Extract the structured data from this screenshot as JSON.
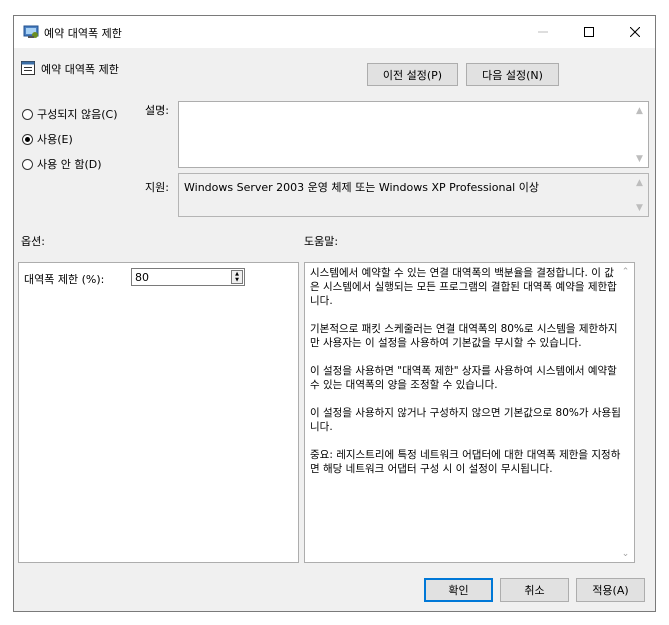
{
  "window": {
    "title": "예약 대역폭 제한",
    "minimize_icon": "minimize-icon",
    "maximize_icon": "maximize-icon",
    "close_icon": "close-icon"
  },
  "header": {
    "setting_title": "예약 대역폭 제한",
    "prev_button": "이전 설정(P)",
    "next_button": "다음 설정(N)"
  },
  "state": {
    "options": [
      {
        "label": "구성되지 않음(C)",
        "selected": false
      },
      {
        "label": "사용(E)",
        "selected": true
      },
      {
        "label": "사용 안 함(D)",
        "selected": false
      }
    ]
  },
  "labels": {
    "comment": "설명:",
    "supported": "지원:",
    "options": "옵션:",
    "help": "도움말:"
  },
  "comment": {
    "value": ""
  },
  "supported": {
    "value": "Windows Server 2003 운영 체제 또는 Windows XP Professional 이상"
  },
  "options_panel": {
    "bandwidth_label": "대역폭 제한 (%):",
    "bandwidth_value": "80"
  },
  "help_text": [
    "시스템에서 예약할 수 있는 연결 대역폭의 백분율을 결정합니다. 이 값은 시스템에서 실행되는 모든 프로그램의 결합된 대역폭 예약을 제한합니다.",
    "기본적으로 패킷 스케줄러는 연결 대역폭의 80%로 시스템을 제한하지만 사용자는 이 설정을 사용하여 기본값을 무시할 수 있습니다.",
    "이 설정을 사용하면 \"대역폭 제한\" 상자를 사용하여 시스템에서 예약할 수 있는 대역폭의 양을 조정할 수 있습니다.",
    "이 설정을 사용하지 않거나 구성하지 않으면 기본값으로 80%가 사용됩니다.",
    "중요: 레지스트리에 특정 네트워크 어댑터에 대한 대역폭 제한을 지정하면 해당 네트워크 어댑터 구성 시 이 설정이 무시됩니다."
  ],
  "footer": {
    "ok": "확인",
    "cancel": "취소",
    "apply": "적용(A)"
  }
}
